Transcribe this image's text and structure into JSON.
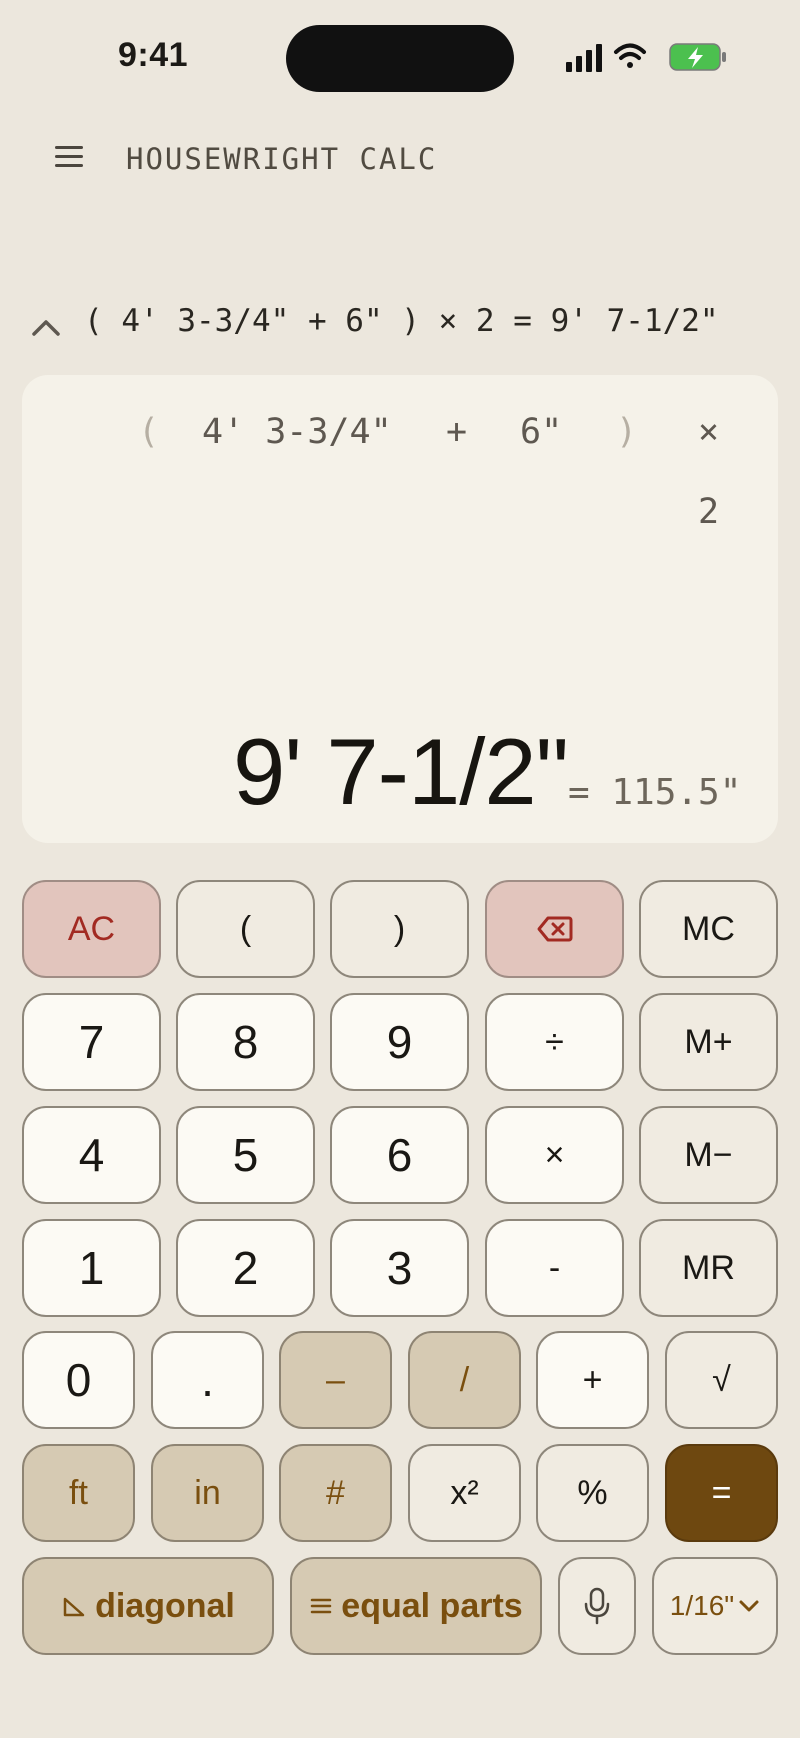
{
  "status": {
    "time": "9:41"
  },
  "header": {
    "title": "HOUSEWRIGHT CALC"
  },
  "history": {
    "expression": "( 4' 3-3/4\" + 6\" ) × 2 = 9' 7-1/2\""
  },
  "display": {
    "tokens_row1": [
      "(",
      "4' 3-3/4\"",
      "+",
      "6\"",
      ")",
      "×"
    ],
    "tokens_row2": [
      "2"
    ],
    "result": "9' 7-1/2\"",
    "inches": "= 115.5\""
  },
  "keys": {
    "row1": [
      "AC",
      "(",
      ")",
      "",
      "MC"
    ],
    "row2": [
      "7",
      "8",
      "9",
      "÷",
      "M+"
    ],
    "row3": [
      "4",
      "5",
      "6",
      "×",
      "M−"
    ],
    "row4": [
      "1",
      "2",
      "3",
      "-",
      "MR"
    ],
    "row5": [
      "0",
      ".",
      "–",
      "/",
      "+",
      "√"
    ],
    "row6": [
      "ft",
      "in",
      "#",
      "x²",
      "%",
      "="
    ]
  },
  "bottom": {
    "diagonal": "diagonal",
    "equal_parts": "equal parts",
    "precision": "1/16\""
  },
  "colors": {
    "accent": "#6e4810",
    "clear": "#a22a22",
    "background": "#ece7dd"
  },
  "icons": [
    "menu-icon",
    "chevron-up-icon",
    "backspace-icon",
    "microphone-icon",
    "chevron-down-icon",
    "triangle-icon",
    "list-icon",
    "wifi-icon",
    "battery-icon",
    "signal-icon"
  ]
}
